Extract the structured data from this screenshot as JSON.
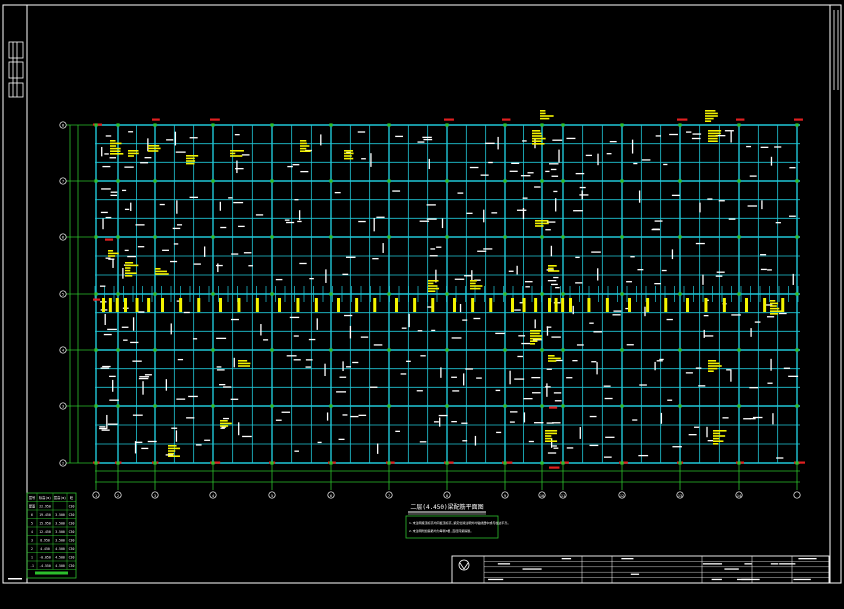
{
  "drawing": {
    "background": "#000000",
    "colors": {
      "border": "#ffffff",
      "beam": "#20c8d8",
      "axis": "#2cc02c",
      "annot_yellow": "#f4f400",
      "annot_red": "#e02020",
      "text_white": "#ffffff"
    },
    "row_axes": [
      "8",
      "7",
      "6",
      "5",
      "4",
      "3",
      "2"
    ],
    "col_axes": [
      "1",
      "2",
      "3",
      "4",
      "5",
      "6",
      "7",
      "8",
      "9",
      "10",
      "11",
      "12",
      "13",
      "14"
    ],
    "plan_title": "二层(4.450)梁配筋平面图",
    "notes": [
      "1.未注明梁顶标高均同板顶标高,梁定位除注明外均轴线居中或与柱边平齐。",
      "2.未注明附加箍筋均为每侧3根,直径同梁箍筋。"
    ],
    "level_table": {
      "rows": [
        [
          "屋面",
          "22.950",
          "",
          "C30"
        ],
        [
          "6",
          "19.450",
          "3.500",
          "C30"
        ],
        [
          "5",
          "15.950",
          "3.500",
          "C30"
        ],
        [
          "4",
          "12.450",
          "3.500",
          "C30"
        ],
        [
          "3",
          "8.950",
          "3.500",
          "C30"
        ],
        [
          "2",
          "4.450",
          "4.500",
          "C30"
        ],
        [
          "1",
          "-0.050",
          "4.500",
          "C30"
        ],
        [
          "-1",
          "-4.550",
          "4.500",
          "C30"
        ]
      ],
      "header": [
        "层号",
        "标高(m)",
        "层高(m)",
        "砼"
      ]
    }
  }
}
